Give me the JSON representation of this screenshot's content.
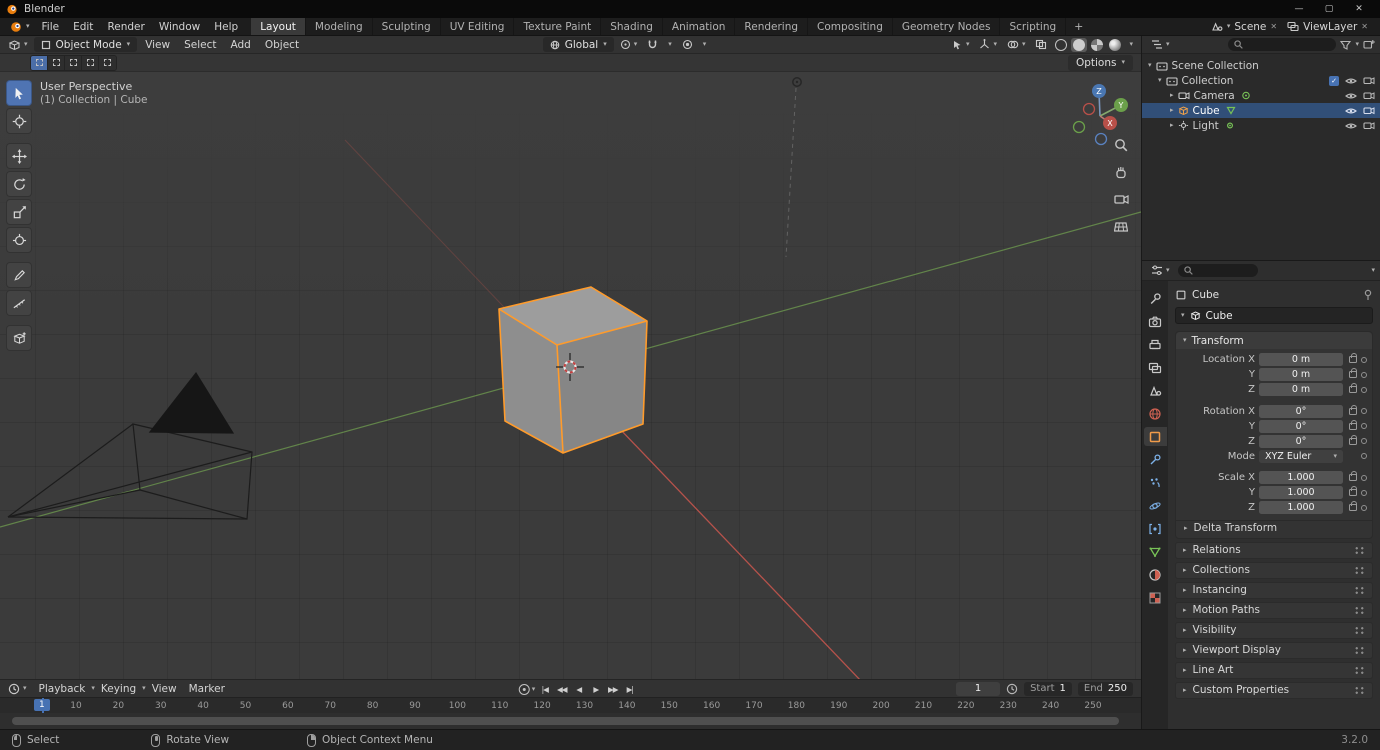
{
  "app": {
    "colors": {
      "accent_blue": "#4772b3",
      "selection_orange": "#ff9b2b",
      "object_tab_orange": "#f09b4a",
      "axis_x_red": "#c4554d",
      "axis_y_green": "#6f9d4f",
      "axis_z_blue": "#4a77b2",
      "outliner_selected_row": "#314f78"
    }
  },
  "icons": {
    "chevron_down": "▾",
    "chevron_right": "▸",
    "close": "✕",
    "minimize": "—",
    "maximize": "▢",
    "check": "✓"
  },
  "titlebar": {
    "title": "Blender"
  },
  "menubar": {
    "menus": [
      "File",
      "Edit",
      "Render",
      "Window",
      "Help"
    ],
    "workspaces": [
      "Layout",
      "Modeling",
      "Sculpting",
      "UV Editing",
      "Texture Paint",
      "Shading",
      "Animation",
      "Rendering",
      "Compositing",
      "Geometry Nodes",
      "Scripting"
    ],
    "active_workspace": "Layout",
    "add_workspace_label": "+",
    "scene": {
      "label": "Scene"
    },
    "view_layer": {
      "label": "ViewLayer"
    }
  },
  "viewport": {
    "header": {
      "mode": "Object Mode",
      "menus": [
        "View",
        "Select",
        "Add",
        "Object"
      ],
      "orientation": "Global"
    },
    "tool_settings": {
      "options_label": "Options"
    },
    "overlay": {
      "view_label": "User Perspective",
      "context_label": "(1) Collection | Cube"
    },
    "gizmo": {
      "x": "X",
      "y": "Y",
      "z": "Z"
    }
  },
  "toolbar": {
    "tools": [
      "select-box",
      "cursor",
      "move",
      "rotate",
      "scale",
      "transform",
      "annotate",
      "measure",
      "add-cube"
    ],
    "active_tool": "select-box"
  },
  "timeline": {
    "menus": [
      "Playback",
      "Keying",
      "View",
      "Marker"
    ],
    "transport": [
      "|◀",
      "◀◀",
      "◀",
      "▶",
      "▶▶",
      "▶|"
    ],
    "current_frame": "1",
    "start_label": "Start",
    "start_value": "1",
    "end_label": "End",
    "end_value": "250",
    "ticks": [
      "10",
      "20",
      "30",
      "40",
      "50",
      "60",
      "70",
      "80",
      "90",
      "100",
      "110",
      "120",
      "130",
      "140",
      "150",
      "160",
      "170",
      "180",
      "190",
      "200",
      "210",
      "220",
      "230",
      "240",
      "250"
    ]
  },
  "statusbar": {
    "left_click": "Select",
    "middle_click": "Rotate View",
    "right_click": "Object Context Menu",
    "version": "3.2.0"
  },
  "outliner": {
    "rows": [
      {
        "label": "Scene Collection",
        "icon": "collection"
      },
      {
        "label": "Collection",
        "icon": "collection"
      },
      {
        "label": "Camera",
        "icon": "camera-object"
      },
      {
        "label": "Cube",
        "icon": "mesh-object",
        "selected": true
      },
      {
        "label": "Light",
        "icon": "light-object"
      }
    ]
  },
  "properties": {
    "breadcrumb": "Cube",
    "object_name": "Cube",
    "tabs": [
      "tool",
      "render",
      "output",
      "view-layer",
      "scene",
      "world",
      "object",
      "modifiers",
      "particles",
      "physics",
      "constraints",
      "object-data",
      "material",
      "texture"
    ],
    "active_tab": "object",
    "transform": {
      "title": "Transform",
      "rows": [
        {
          "label": "Location X",
          "value": "0 m"
        },
        {
          "label": "Y",
          "value": "0 m"
        },
        {
          "label": "Z",
          "value": "0 m"
        },
        {
          "label": "Rotation X",
          "value": "0°"
        },
        {
          "label": "Y",
          "value": "0°"
        },
        {
          "label": "Z",
          "value": "0°"
        },
        {
          "label": "Mode",
          "value": "XYZ Euler"
        },
        {
          "label": "Scale X",
          "value": "1.000"
        },
        {
          "label": "Y",
          "value": "1.000"
        },
        {
          "label": "Z",
          "value": "1.000"
        }
      ]
    },
    "panels": [
      "Delta Transform",
      "Relations",
      "Collections",
      "Instancing",
      "Motion Paths",
      "Visibility",
      "Viewport Display",
      "Line Art",
      "Custom Properties"
    ]
  }
}
